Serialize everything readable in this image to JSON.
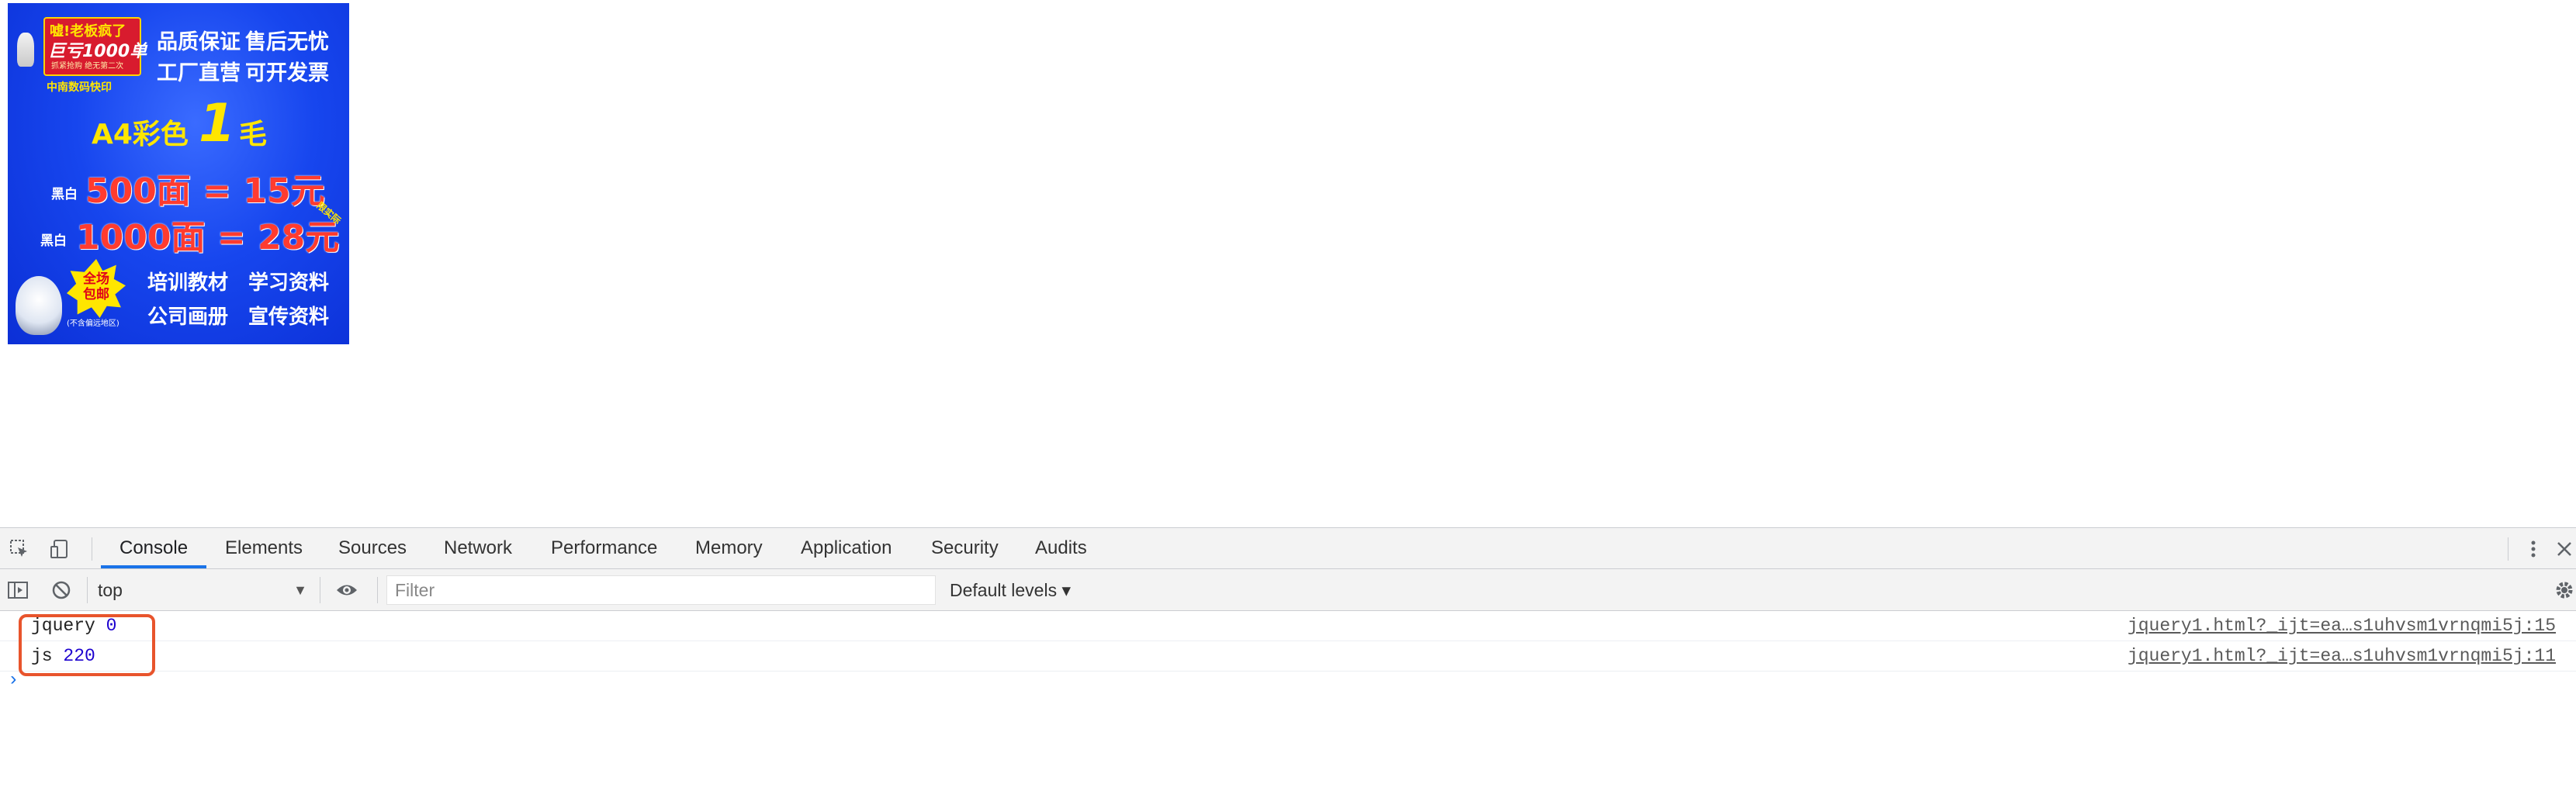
{
  "ad": {
    "promo_line1": "嘘!老板疯了",
    "promo_line2": "巨亏1000单",
    "promo_line3": "抓紧抢购 绝无第二次",
    "shop_name": "中南数码快印",
    "slogan_1": "品质保证",
    "slogan_2": "售后无忧",
    "slogan_3": "工厂直营",
    "slogan_4": "可开发票",
    "a4_text": "A4彩色",
    "a4_price": "1",
    "a4_unit": "毛",
    "bw_label_1": "黑白",
    "bw_price_1": "500面 = 15元",
    "bw_label_2": "黑白",
    "bw_price_2": "1000面 = 28元",
    "corner_text": "限实际",
    "star_text": "全场包邮",
    "star_note": "(不含偏远地区)",
    "service_1": "培训教材",
    "service_2": "学习资料",
    "service_3": "公司画册",
    "service_4": "宣传资料",
    "colors": {
      "background": "#1746ee",
      "yellow": "#ffe600",
      "red": "#ff3b2f"
    }
  },
  "devtools": {
    "tabs": [
      {
        "label": "Console",
        "active": true
      },
      {
        "label": "Elements"
      },
      {
        "label": "Sources"
      },
      {
        "label": "Network"
      },
      {
        "label": "Performance"
      },
      {
        "label": "Memory"
      },
      {
        "label": "Application"
      },
      {
        "label": "Security"
      },
      {
        "label": "Audits"
      }
    ],
    "icons": {
      "inspect": "inspect-element-icon",
      "device": "device-toolbar-icon",
      "more": "more-vertical-icon",
      "close": "close-icon",
      "sidebar": "console-sidebar-icon",
      "clear": "clear-console-icon",
      "eye": "eye-icon",
      "settings": "gear-icon"
    },
    "toolbar": {
      "context": "top",
      "filter_placeholder": "Filter",
      "levels": "Default levels ▾"
    },
    "messages": [
      {
        "label": "jquery",
        "value": "0",
        "source": "jquery1.html?_ijt=ea…s1uhvsm1vrnqmi5j:15"
      },
      {
        "label": "js",
        "value": "220",
        "source": "jquery1.html?_ijt=ea…s1uhvsm1vrnqmi5j:11"
      }
    ],
    "prompt": "›",
    "accent_color": "#1a73e8",
    "highlight_color": "#e8542c"
  }
}
